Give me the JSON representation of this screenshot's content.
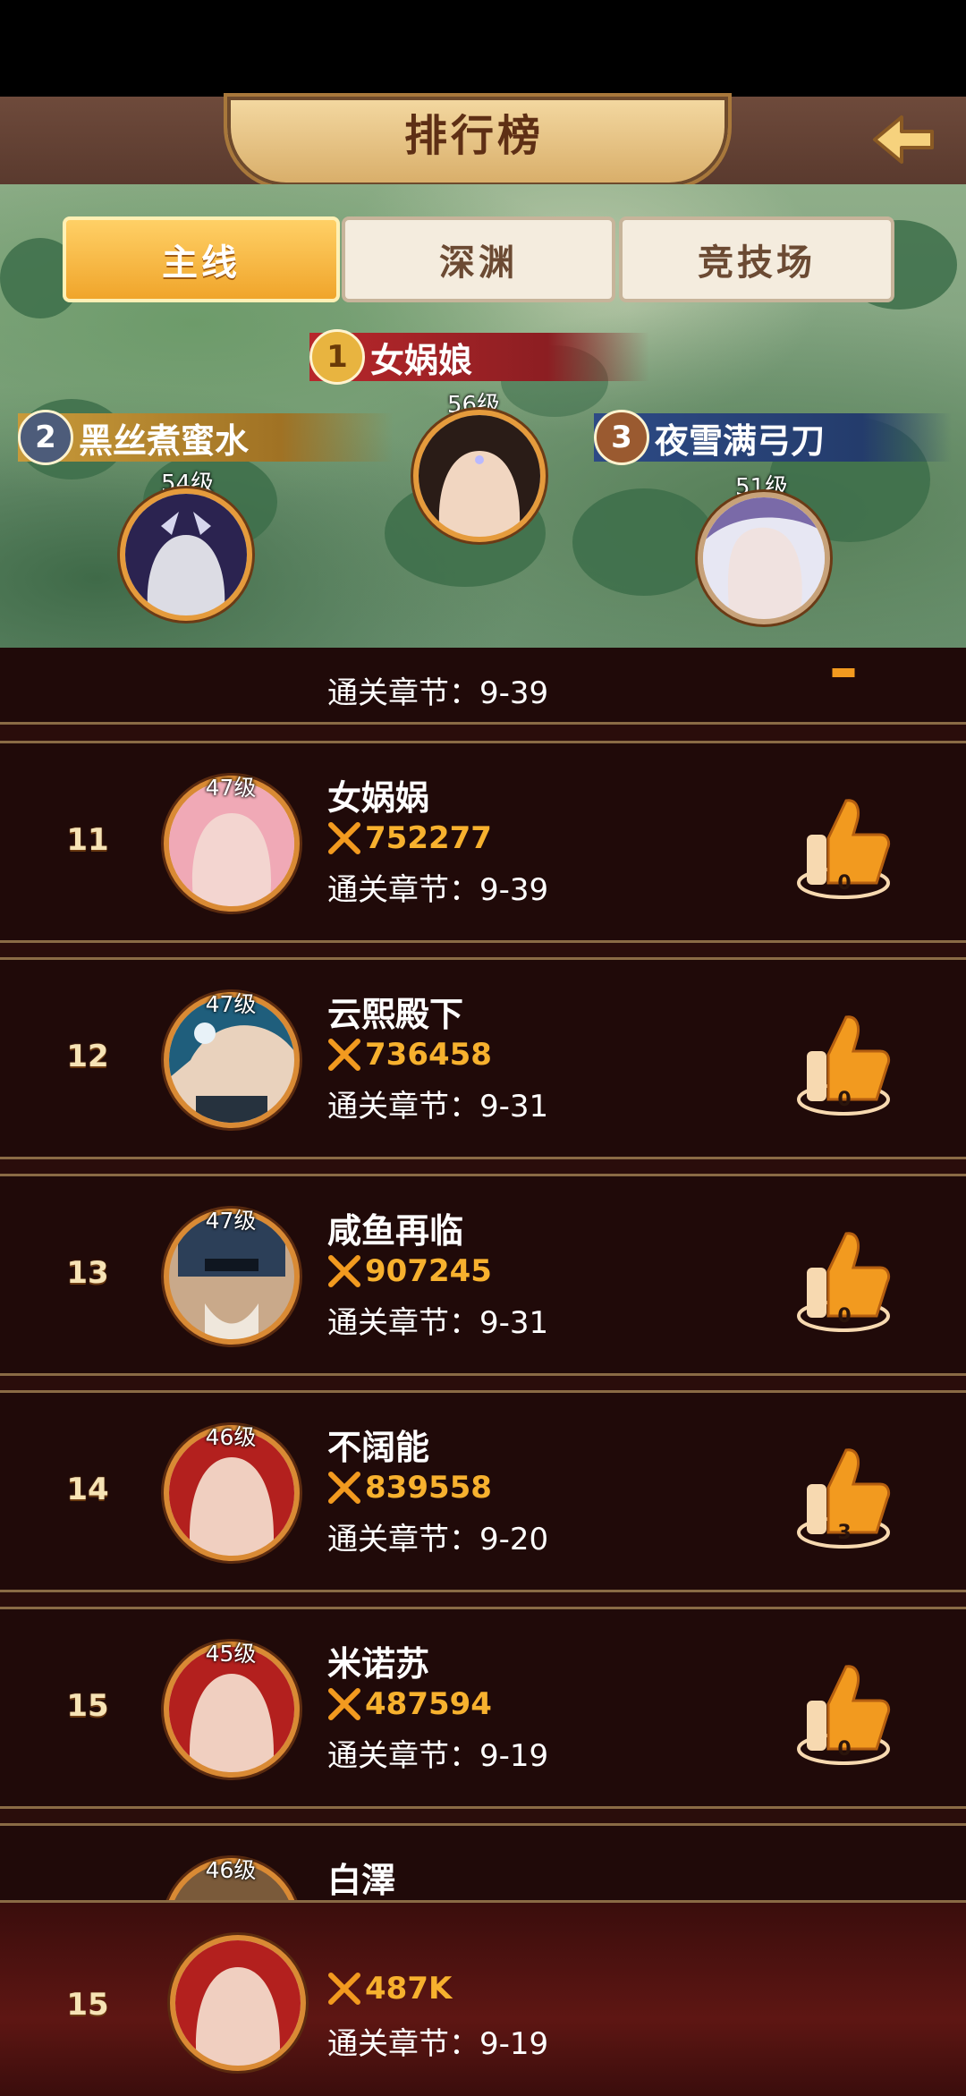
{
  "header": {
    "title": "排行榜",
    "back_icon": "arrow-back-icon"
  },
  "tabs": [
    {
      "label": "主线",
      "active": true
    },
    {
      "label": "深渊",
      "active": false
    },
    {
      "label": "竞技场",
      "active": false
    }
  ],
  "podium": {
    "first": {
      "rank": "1",
      "name": "女娲娘",
      "level": "56级"
    },
    "second": {
      "rank": "2",
      "name": "黑丝煮蜜水",
      "level": "54级"
    },
    "third": {
      "rank": "3",
      "name": "夜雪满弓刀",
      "level": "51级"
    }
  },
  "partial_row": {
    "chapter": "通关章节：9-39"
  },
  "rows": [
    {
      "rank": "11",
      "level": "47级",
      "name": "女娲娲",
      "power": "752277",
      "chapter": "通关章节：9-39",
      "likes": "0"
    },
    {
      "rank": "12",
      "level": "47级",
      "name": "云熙殿下",
      "power": "736458",
      "chapter": "通关章节：9-31",
      "likes": "0"
    },
    {
      "rank": "13",
      "level": "47级",
      "name": "咸鱼再临",
      "power": "907245",
      "chapter": "通关章节：9-31",
      "likes": "0"
    },
    {
      "rank": "14",
      "level": "46级",
      "name": "不阔能",
      "power": "839558",
      "chapter": "通关章节：9-20",
      "likes": "3"
    },
    {
      "rank": "15",
      "level": "45级",
      "name": "米诺苏",
      "power": "487594",
      "chapter": "通关章节：9-19",
      "likes": "0"
    },
    {
      "rank": "",
      "level": "46级",
      "name": "白澤",
      "power": "",
      "chapter": "",
      "likes": ""
    }
  ],
  "self": {
    "rank": "15",
    "power": "487K",
    "chapter": "通关章节：9-19"
  },
  "colors": {
    "accent": "#f7b12e",
    "row_bg": "#200a09",
    "border": "#8a6b45"
  }
}
